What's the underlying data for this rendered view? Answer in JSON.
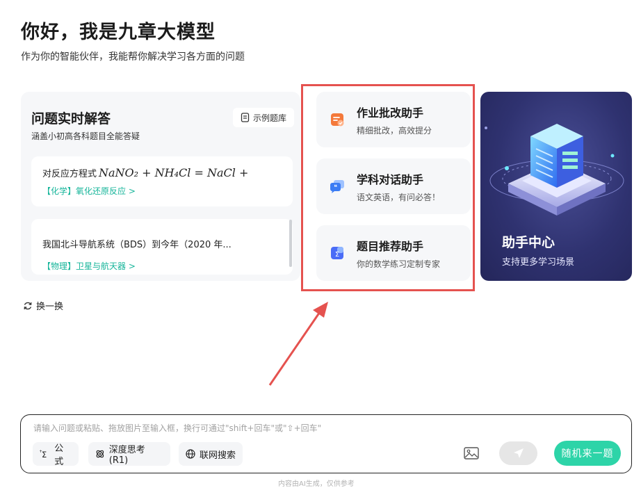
{
  "header": {
    "title": "你好，我是九章大模型",
    "subtitle": "作为你的智能伙伴，我能帮你解决学习各方面的问题"
  },
  "qa_card": {
    "title": "问题实时解答",
    "subtitle": "涵盖小初高各科题目全能答疑",
    "example_label": "示例题库",
    "questions": [
      {
        "text": "对反应方程式",
        "formula": "NaNO₂ + NH₄Cl = NaCl +",
        "tag": "【化学】氧化还原反应 >"
      },
      {
        "text": "我国北斗导航系统（BDS）到今年（2020 年...",
        "tag": "【物理】卫星与航天器 >"
      }
    ]
  },
  "refresh_label": "换一换",
  "assistants": [
    {
      "name": "作业批改助手",
      "desc": "精细批改，高效提分",
      "icon": "homework-correct-icon",
      "color": "#f4793b"
    },
    {
      "name": "学科对话助手",
      "desc": "语文英语，有问必答！",
      "icon": "chat-bubble-icon",
      "color": "#3b7cf4"
    },
    {
      "name": "题目推荐助手",
      "desc": "你的数学练习定制专家",
      "icon": "sigma-doc-icon",
      "color": "#4a6cf7"
    }
  ],
  "center_card": {
    "title": "助手中心",
    "subtitle": "支持更多学习场景"
  },
  "input": {
    "placeholder": "请输入问题或粘贴、拖放图片至输入框，换行可通过\"shift+回车\"或\"⇧+回车\"",
    "tools": [
      {
        "label": "公式",
        "icon": "sigma-icon"
      },
      {
        "label": "深度思考(R1)",
        "icon": "deep-think-icon"
      },
      {
        "label": "联网搜索",
        "icon": "globe-icon"
      }
    ],
    "random_label": "随机来一题"
  },
  "footer_note": "内容由AI生成，仅供参考",
  "colors": {
    "accent": "#2dd4a8",
    "tag_green": "#16b59a",
    "highlight_red": "#e5524f"
  }
}
